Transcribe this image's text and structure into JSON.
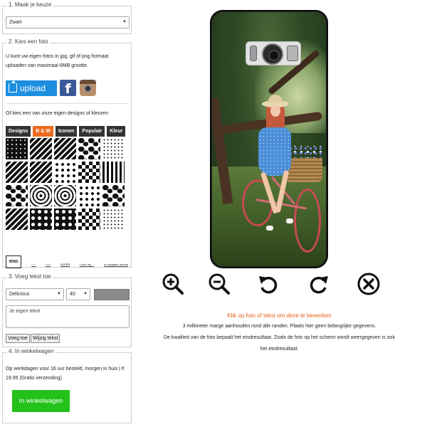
{
  "step1": {
    "legend": "1. Maak je keuze",
    "color_select": "Zwart"
  },
  "step2": {
    "legend": "2. Kies een foto",
    "description": "U kunt uw eigen fotos in jpg, gif of png formaat uploaden van maximaal 6MB grootte.",
    "upload_label": "upload",
    "facebook_icon": "facebook-icon",
    "instagram_icon": "instagram-icon",
    "designs_heading": "Of kies een van onze eigen designs of kleuren:",
    "tabs": [
      {
        "label": "Designs",
        "active": false
      },
      {
        "label": "B & W",
        "active": true
      },
      {
        "label": "Iconen",
        "active": false
      },
      {
        "label": "Populair",
        "active": false
      },
      {
        "label": "Kleur",
        "active": false
      }
    ],
    "patterns": [
      "p-dots-w",
      "p-dash",
      "p-dash",
      "p-blob",
      "p-fine",
      "p-dash",
      "p-dash",
      "p-dots-b",
      "p-check",
      "p-stripes-v",
      "p-blob",
      "p-waves",
      "p-waves",
      "p-dots-b",
      "p-blob",
      "p-dash",
      "p-solid-dots",
      "p-solid-dots",
      "p-check",
      "p-fine"
    ],
    "logos": [
      "WINS",
      "~~~",
      "===",
      "SUPER",
      "I love my ...",
      "le voyageur monde"
    ]
  },
  "step3": {
    "legend": "3. Voeg tekst toe",
    "font_select": "Delicious",
    "size_select": "40",
    "swatch_color": "#8a8a8a",
    "text_placeholder": "Je eigen tekst",
    "add_button": "Voeg toe",
    "edit_button": "Wijzig tekst"
  },
  "step4": {
    "legend": "4. In winkelwagen",
    "delivery": "Op werkdagen voor 16 uur besteld, morgen in huis | € 19.95 (Gratis verzending)",
    "cart_button": "In winkelwagen",
    "cart_button_color": "#22c21a"
  },
  "toolbar": {
    "icons": [
      "zoom-in-icon",
      "zoom-out-icon",
      "rotate-left-icon",
      "rotate-right-icon",
      "delete-icon"
    ]
  },
  "info": {
    "hint": "Klik op foto of tekst om deze te bewerken",
    "line1": "3 millimeter marge aanhouden rond alle randen. Plaats hier geen belangrijke gegevens.",
    "line2": "De kwaliteit van de foto bepaalt het eindresultaat. Zoals de foto op het scherm wordt weergegeven is ook",
    "line3": "het eindresultaat."
  },
  "colors": {
    "accent": "#ec6b1f",
    "upload": "#1d8fe0",
    "facebook": "#3b5998",
    "hint": "#e6621a"
  }
}
